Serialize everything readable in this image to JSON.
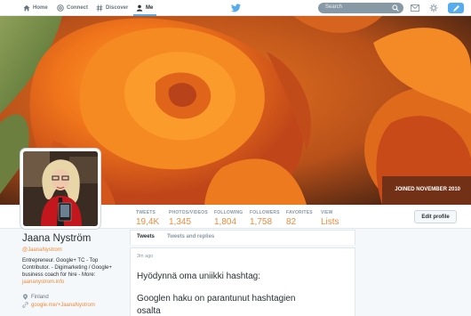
{
  "nav": {
    "home": "Home",
    "connect": "Connect",
    "discover": "Discover",
    "me": "Me",
    "search_placeholder": "Search"
  },
  "header": {
    "joined": "JOINED NOVEMBER 2010"
  },
  "stats": [
    {
      "label": "TWEETS",
      "value": "19,4K"
    },
    {
      "label": "PHOTOS/VIDEOS",
      "value": "1,345"
    },
    {
      "label": "FOLLOWING",
      "value": "1,804"
    },
    {
      "label": "FOLLOWERS",
      "value": "1,758"
    },
    {
      "label": "FAVORITES",
      "value": "82"
    },
    {
      "label": "VIEW",
      "value": "Lists"
    }
  ],
  "edit_profile": "Edit profile",
  "profile": {
    "name": "Jaana Nyström",
    "handle": "@JaanaNystrom",
    "bio_line1": "Entrepreneur. Google+ TC - Top",
    "bio_line2": "Contributor.  - Digimarketing / Google+",
    "bio_line3": "business coach for hire - More:",
    "link": "jaananystrom.info",
    "location": "Finland",
    "url": "google.me/+JaanaNystrom"
  },
  "tabs": {
    "tweets": "Tweets",
    "replies": "Tweets and replies"
  },
  "tweet": {
    "time": "3m ago",
    "line1": "Hyödynnä oma uniikki hashtag:",
    "line2": "Googlen haku on parantunut hashtagien",
    "line3": "osalta"
  },
  "colors": {
    "accent": "#ef8a3c",
    "twitter_blue": "#55acee"
  }
}
